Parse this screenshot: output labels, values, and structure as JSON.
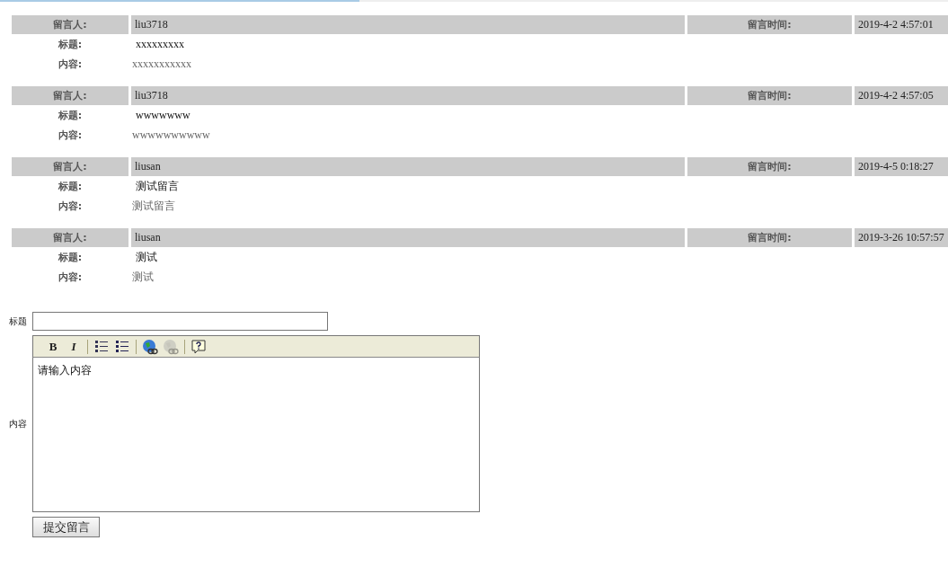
{
  "messages": [
    {
      "author_label": "留言人:",
      "author": "liu3718",
      "time_label": "留言时间:",
      "time": "2019-4-2 4:57:01",
      "title_label": "标题:",
      "title": "xxxxxxxxx",
      "content_label": "内容:",
      "content": "xxxxxxxxxxx"
    },
    {
      "author_label": "留言人:",
      "author": "liu3718",
      "time_label": "留言时间:",
      "time": "2019-4-2 4:57:05",
      "title_label": "标题:",
      "title": "wwwwwww",
      "content_label": "内容:",
      "content": "wwwwwwwwww"
    },
    {
      "author_label": "留言人:",
      "author": "liusan",
      "time_label": "留言时间:",
      "time": "2019-4-5 0:18:27",
      "title_label": "标题:",
      "title": "测试留言",
      "content_label": "内容:",
      "content": "测试留言"
    },
    {
      "author_label": "留言人:",
      "author": "liusan",
      "time_label": "留言时间:",
      "time": "2019-3-26 10:57:57",
      "title_label": "标题:",
      "title": "测试",
      "content_label": "内容:",
      "content": "测试"
    }
  ],
  "form": {
    "title_label": "标题",
    "content_label": "内容",
    "editor_value": "请输入内容",
    "submit": "提交留言",
    "toolbar": [
      {
        "kind": "bold",
        "label": "B",
        "disabled": false
      },
      {
        "kind": "italic",
        "label": "I",
        "disabled": false
      },
      {
        "kind": "separator"
      },
      {
        "kind": "ordered-list",
        "disabled": false
      },
      {
        "kind": "bullet-list",
        "disabled": false
      },
      {
        "kind": "separator"
      },
      {
        "kind": "link",
        "disabled": false
      },
      {
        "kind": "unlink",
        "disabled": true
      },
      {
        "kind": "separator"
      },
      {
        "kind": "help",
        "disabled": false
      }
    ]
  }
}
